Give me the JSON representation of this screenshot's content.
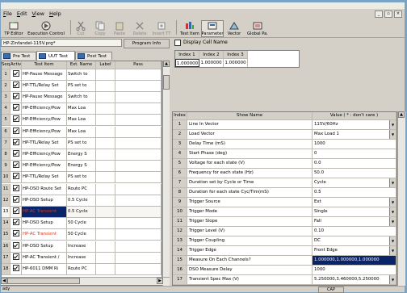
{
  "menu": [
    "File",
    "Edit",
    "View",
    "Help"
  ],
  "window_controls": [
    "_",
    "▫",
    "×"
  ],
  "toolbar": {
    "ip_editor": "TP Editor",
    "execution_control": "Execution Control",
    "cut": "Cut",
    "copy": "Copy",
    "paste": "Paste",
    "delete": "Delete",
    "insert_tt": "Insert TT",
    "test_item": "Test Item",
    "parameter": "Parameter",
    "vector": "Vector",
    "global_pa": "Global Pa."
  },
  "program": {
    "path": "HP-Zinfandel-115V.prg*",
    "info_button": "Program Info"
  },
  "tabs": [
    "Pre Test",
    "UUT Test",
    "Post Test"
  ],
  "test_grid": {
    "columns": [
      "Seq.",
      "Active",
      "Test Item",
      "Ext. Name",
      "Label",
      "Pass"
    ],
    "rows": [
      {
        "seq": "1",
        "item": "HP-Pause Message",
        "ext": "Switch to",
        "red": false
      },
      {
        "seq": "2",
        "item": "HP-TTL/Relay Set",
        "ext": "PS set to",
        "red": false
      },
      {
        "seq": "3",
        "item": "HP-Pause Message",
        "ext": "Switch to",
        "red": false
      },
      {
        "seq": "4",
        "item": "HP-Efficiency/Pow",
        "ext": "Max Loa",
        "red": false
      },
      {
        "seq": "5",
        "item": "HP-Efficiency/Pow",
        "ext": "Max Loa",
        "red": false
      },
      {
        "seq": "6",
        "item": "HP-Efficiency/Pow",
        "ext": "Max Loa",
        "red": false
      },
      {
        "seq": "7",
        "item": "HP-TTL/Relay Set",
        "ext": "PS set to",
        "red": false
      },
      {
        "seq": "8",
        "item": "HP-Efficiency/Pow",
        "ext": "Energy S",
        "red": false
      },
      {
        "seq": "9",
        "item": "HP-Efficiency/Pow",
        "ext": "Energy S",
        "red": false
      },
      {
        "seq": "10",
        "item": "HP-TTL/Relay Set",
        "ext": "PS set to",
        "red": false
      },
      {
        "seq": "11",
        "item": "HP-DSO Route Set",
        "ext": "Route PC",
        "red": false
      },
      {
        "seq": "12",
        "item": "HP-DSO Setup",
        "ext": "0.5 Cycle",
        "red": false
      },
      {
        "seq": "13",
        "item": "HP-AC Transient",
        "ext": "0.5 Cycle",
        "red": true,
        "selected": true
      },
      {
        "seq": "14",
        "item": "HP-DSO Setup",
        "ext": "50 Cycle",
        "red": false
      },
      {
        "seq": "15",
        "item": "HP-AC Transient",
        "ext": "50 Cycle",
        "red": true
      },
      {
        "seq": "16",
        "item": "HP-DSO Setup",
        "ext": "Increase",
        "red": false
      },
      {
        "seq": "17",
        "item": "HP-AC Transient /",
        "ext": "Increase",
        "red": false
      },
      {
        "seq": "18",
        "item": "HP-6011 DMM Ri",
        "ext": "Route PC",
        "red": false
      }
    ]
  },
  "display_cell_name": "Display Cell Name",
  "index_grid": {
    "headers": [
      "Index 1",
      "Index 2",
      "Index 3"
    ],
    "values": [
      "1.000000",
      "1.000000",
      "1.000000"
    ]
  },
  "param_grid": {
    "columns": [
      "Index",
      "Show Name",
      "Value ( * : don't care )"
    ],
    "rows": [
      {
        "i": "1",
        "name": "Line In Vector",
        "value": "115V/60Hz",
        "dd": true
      },
      {
        "i": "2",
        "name": "Load Vector",
        "value": "Max Load 1",
        "dd": true
      },
      {
        "i": "3",
        "name": "Delay Time (mS)",
        "value": "1000",
        "dd": false
      },
      {
        "i": "4",
        "name": "Start Phase (deg)",
        "value": "0",
        "dd": false
      },
      {
        "i": "5",
        "name": "Voltage for each state (V)",
        "value": "0.0",
        "dd": false
      },
      {
        "i": "6",
        "name": "Frequency for each state (Hz)",
        "value": "50.0",
        "dd": false
      },
      {
        "i": "7",
        "name": "Duration set by Cycle or Time",
        "value": "Cycle",
        "dd": true
      },
      {
        "i": "8",
        "name": "Duration for each state Cyc/Tim(mS)",
        "value": "0.5",
        "dd": false
      },
      {
        "i": "9",
        "name": "Trigger Source",
        "value": "Ext",
        "dd": true
      },
      {
        "i": "10",
        "name": "Trigger Mode",
        "value": "Single",
        "dd": true
      },
      {
        "i": "11",
        "name": "Trigger Slope",
        "value": "Fall",
        "dd": true
      },
      {
        "i": "12",
        "name": "Trigger Level (V)",
        "value": "0.10",
        "dd": false
      },
      {
        "i": "13",
        "name": "Trigger Coupling",
        "value": "DC",
        "dd": true
      },
      {
        "i": "14",
        "name": "Trigger Edge",
        "value": "Front Edge",
        "dd": true
      },
      {
        "i": "15",
        "name": "Measure On Each Channels?",
        "value": "1.000000,1.000000,1.000000",
        "dd": false,
        "hl": true
      },
      {
        "i": "16",
        "name": "DSO Measure Delay",
        "value": "1000",
        "dd": false
      },
      {
        "i": "17",
        "name": "Transient Spec Max (V)",
        "value": "5.250000,3.460000,5.250000",
        "dd": true
      }
    ]
  },
  "status": {
    "left": "ady",
    "cap": "CAP"
  },
  "colors": {
    "selection": "#0a246a",
    "red_text": "#d23b1d",
    "face": "#d4d0c8"
  }
}
